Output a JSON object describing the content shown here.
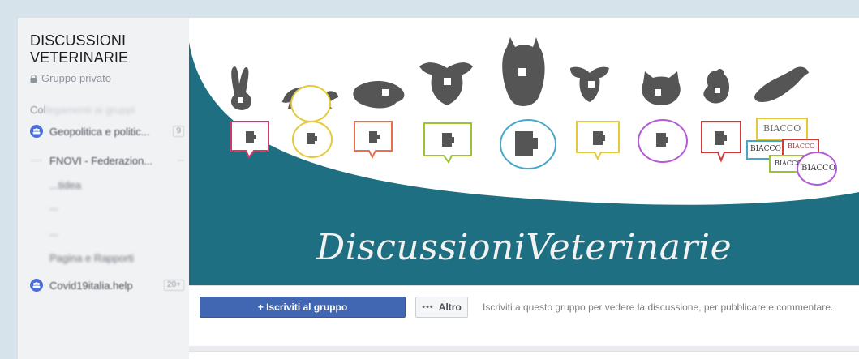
{
  "sidebar": {
    "group_name": "DISCUSSIONI VETERINARIE",
    "privacy": "Gruppo privato",
    "section_label_visible": "Col",
    "section_label_blurred": "legamenti ai gruppi",
    "groups": [
      {
        "name": "Geopolitica e politic...",
        "count": "9",
        "icon": "group-icon"
      },
      {
        "name": "FNOVI - Federazion...",
        "count": "",
        "icon": "group-icon"
      },
      {
        "name": "...tidea",
        "count": "",
        "icon": "group-icon"
      },
      {
        "name": "...",
        "count": "",
        "icon": "group-icon"
      },
      {
        "name": "...",
        "count": "",
        "icon": "group-icon"
      },
      {
        "name": "Pagina e Rapporti",
        "count": "",
        "icon": "group-icon"
      },
      {
        "name": "Covid19italia.help",
        "count": "20+",
        "icon": "group-icon"
      }
    ]
  },
  "cover": {
    "title": "DiscussioniVeterinarie",
    "colors": {
      "teal": "#1e6f82",
      "icons": "#555555"
    },
    "bubble_text": [
      "BIACCO",
      "BIACCO",
      "BIACCO",
      "BIACCO",
      "BIACCO"
    ]
  },
  "actions": {
    "join_label": "+ Iscriviti al gruppo",
    "more_label": "Altro",
    "join_note": "Iscriviti a questo gruppo per vedere la discussione, per pubblicare e commentare."
  }
}
